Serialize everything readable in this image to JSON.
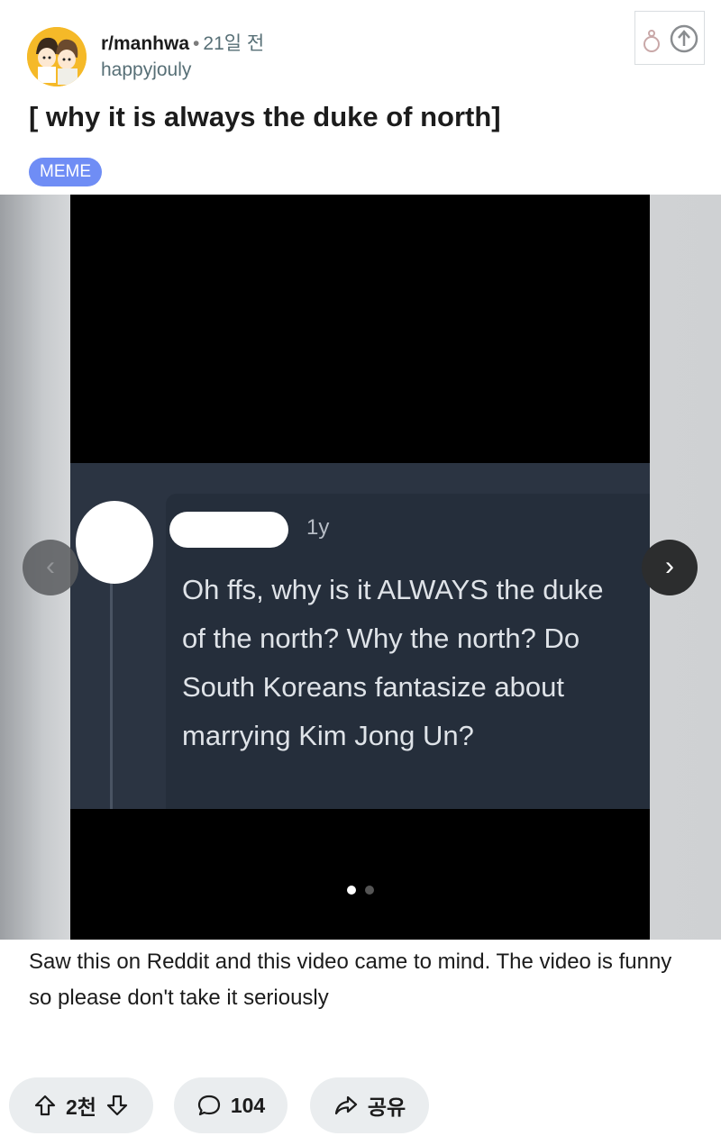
{
  "post": {
    "subreddit": "r/manhwa",
    "separator": "•",
    "time": "21일 전",
    "author": "happyjouly",
    "title": "[ why it is always the duke of north]",
    "flair": "MEME",
    "body": "Saw this on Reddit and this video came to mind. The video is funny so please don't take it seriously"
  },
  "media": {
    "comment_age": "1y",
    "comment_text": "Oh ffs, why is it ALWAYS the duke of the north? Why the north? Do South Koreans fantasize about marrying Kim Jong Un?",
    "prev_glyph": "‹",
    "next_glyph": "›",
    "slide_count": 2,
    "active_slide": 1
  },
  "actions": {
    "vote_count": "2천",
    "comment_count": "104",
    "share_label": "공유"
  },
  "colors": {
    "flair_bg": "#6f8df5",
    "avatar_bg": "#f5b928",
    "pill_bg": "#eaedef"
  },
  "icons": [
    "avatar",
    "corner-icon",
    "upvote-icon",
    "downvote-icon",
    "comment-icon",
    "share-icon",
    "chevron-left-icon",
    "chevron-right-icon"
  ]
}
